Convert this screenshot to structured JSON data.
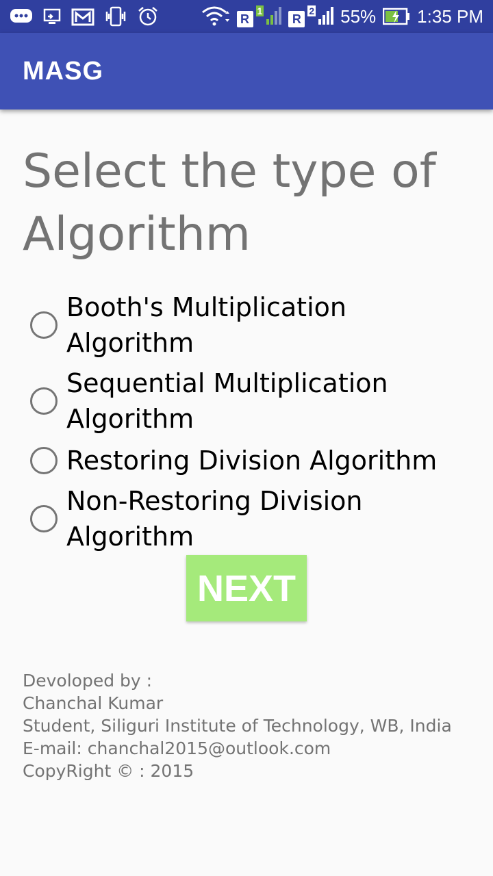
{
  "status_bar": {
    "battery_percent": "55%",
    "time": "1:35 PM",
    "sim1_label": "R",
    "sim1_slot": "1",
    "sim2_label": "R",
    "sim2_slot": "2",
    "icons": [
      "chat-icon",
      "cast-icon",
      "gmail-icon",
      "vibrate-icon",
      "alarm-icon",
      "wifi-icon",
      "signal-icon",
      "battery-charging-icon"
    ]
  },
  "app_bar": {
    "title": "MASG"
  },
  "heading": "Select the type of Algorithm",
  "options": [
    {
      "label": "Booth's Multiplication Algorithm",
      "selected": false
    },
    {
      "label": "Sequential Multiplication Algorithm",
      "selected": false
    },
    {
      "label": "Restoring Division Algorithm",
      "selected": false
    },
    {
      "label": "Non-Restoring Division Algorithm",
      "selected": false
    }
  ],
  "next_button": {
    "label": "NEXT"
  },
  "footer": {
    "developed_by": "Devoloped by :",
    "name": "Chanchal Kumar",
    "affiliation": "Student, Siliguri Institute of Technology, WB, India",
    "email": "E-mail: chanchal2015@outlook.com",
    "copyright": "CopyRight © : 2015"
  },
  "colors": {
    "status_bar": "#303f9f",
    "app_bar": "#3f51b5",
    "next_button": "#a5ea7b",
    "heading_text": "#737373"
  }
}
